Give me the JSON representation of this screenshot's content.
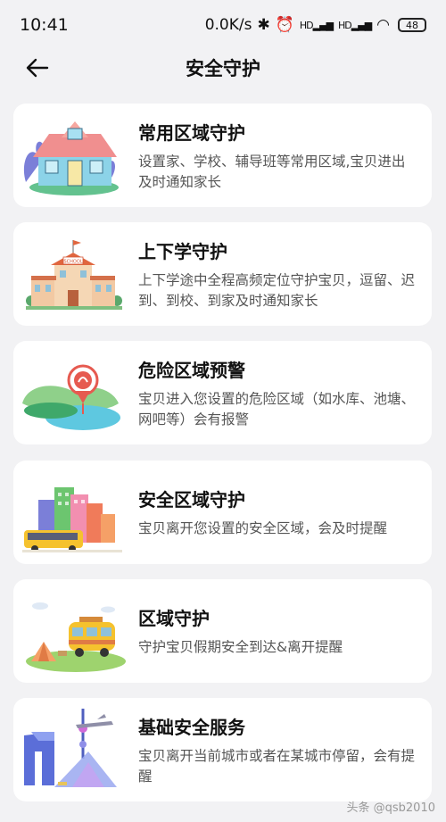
{
  "status": {
    "time": "10:41",
    "speed": "0.0K/s",
    "bluetooth_icon": "✱",
    "alarm_icon": "⏰",
    "signal1": "HD▂▄▆",
    "signal2": "HD▂▄▆",
    "wifi_icon": "◠",
    "battery": "48"
  },
  "header": {
    "title": "安全守护"
  },
  "cards": [
    {
      "title": "常用区域守护",
      "desc": "设置家、学校、辅导班等常用区域,宝贝进出及时通知家长"
    },
    {
      "title": "上下学守护",
      "desc": "上下学途中全程高频定位守护宝贝，逗留、迟到、到校、到家及时通知家长"
    },
    {
      "title": "危险区域预警",
      "desc": "宝贝进入您设置的危险区域（如水库、池塘、网吧等）会有报警"
    },
    {
      "title": "安全区域守护",
      "desc": "宝贝离开您设置的安全区域，会及时提醒"
    },
    {
      "title": "区域守护",
      "desc": "守护宝贝假期安全到达&离开提醒"
    },
    {
      "title": "基础安全服务",
      "desc": "宝贝离开当前城市或者在某城市停留，会有提醒"
    }
  ],
  "watermark": "头条 @qsb2010"
}
